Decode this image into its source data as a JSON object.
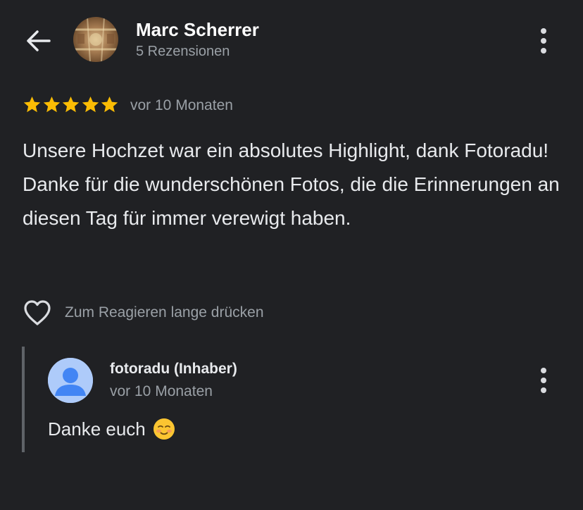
{
  "header": {
    "back_icon": "arrow-left-icon",
    "reviewer_name": "Marc Scherrer",
    "review_count": "5 Rezensionen",
    "menu_icon": "more-vert-icon"
  },
  "review": {
    "rating": 5,
    "max_rating": 5,
    "star_color": "#fbbc04",
    "time": "vor 10 Monaten",
    "text": "Unsere Hochzet war ein absolutes Highlight, dank Fotoradu! Danke für die wunderschönen Fotos, die die Erinnerungen an diesen Tag für immer verewigt haben."
  },
  "reaction": {
    "icon": "heart-outline-icon",
    "label": "Zum Reagieren lange drücken"
  },
  "owner_reply": {
    "name": "fotoradu (Inhaber)",
    "time": "vor 10 Monaten",
    "text": "Danke euch",
    "emoji": "smiling-face-icon",
    "menu_icon": "more-vert-icon"
  },
  "colors": {
    "background": "#202124",
    "text_primary": "#e8eaed",
    "text_secondary": "#9aa0a6",
    "avatar_placeholder": "#aecbfa",
    "avatar_person": "#4285f4"
  }
}
